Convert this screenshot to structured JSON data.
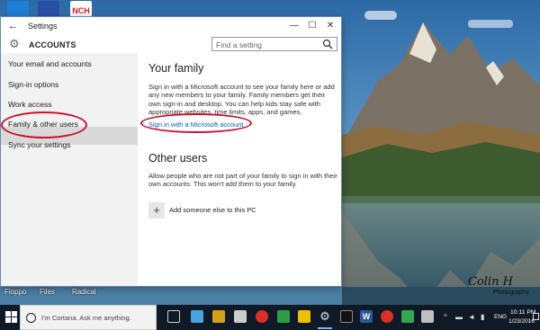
{
  "desktop": {
    "icons": [
      {
        "name": "wifi-app-icon",
        "color": "#1e7fd6"
      },
      {
        "name": "w-app-icon",
        "color": "#2a4fa8"
      },
      {
        "name": "nch-app-icon",
        "color": "#cc1f2d",
        "label": "NCH"
      }
    ],
    "labels": [
      "Floppo",
      "Files",
      "Radical"
    ],
    "signature": "Colin H",
    "signature_sub": "Photography"
  },
  "window": {
    "title": "Settings",
    "header_title": "ACCOUNTS",
    "search": {
      "placeholder": "Find a setting"
    },
    "controls": {
      "minimize": "—",
      "maximize": "☐",
      "close": "✕"
    }
  },
  "sidebar": {
    "items": [
      {
        "label": "Your email and accounts"
      },
      {
        "label": "Sign-in options"
      },
      {
        "label": "Work access"
      },
      {
        "label": "Family & other users"
      },
      {
        "label": "Sync your settings"
      }
    ],
    "active_index": 3
  },
  "content": {
    "family_heading": "Your family",
    "family_text": "Sign in with a Microsoft account to see your family here or add any new members to your family. Family members get their own sign-in and desktop. You can help kids stay safe with appropriate websites, time limits, apps, and games.",
    "signin_link": "Sign in with a Microsoft account",
    "other_heading": "Other users",
    "other_text": "Allow people who are not part of your family to sign in with their own accounts. This won't add them to your family.",
    "add_label": "Add someone else to this PC"
  },
  "taskbar": {
    "cortana_placeholder": "I'm Cortana. Ask me anything.",
    "pinned_colors": [
      "#cccccc",
      "#4aa3df",
      "#d4a017",
      "#cccccc",
      "#d93025",
      "#2e9c45",
      "#f0c000",
      "#cccccc",
      "#111111",
      "#2b579a",
      "#d93025",
      "#33a852",
      "#c0c0c0"
    ],
    "language": "ENG",
    "time": "10:11 PM",
    "date": "1/23/2016"
  },
  "colors": {
    "accent": "#0063b1",
    "annotation": "#c8102e"
  }
}
